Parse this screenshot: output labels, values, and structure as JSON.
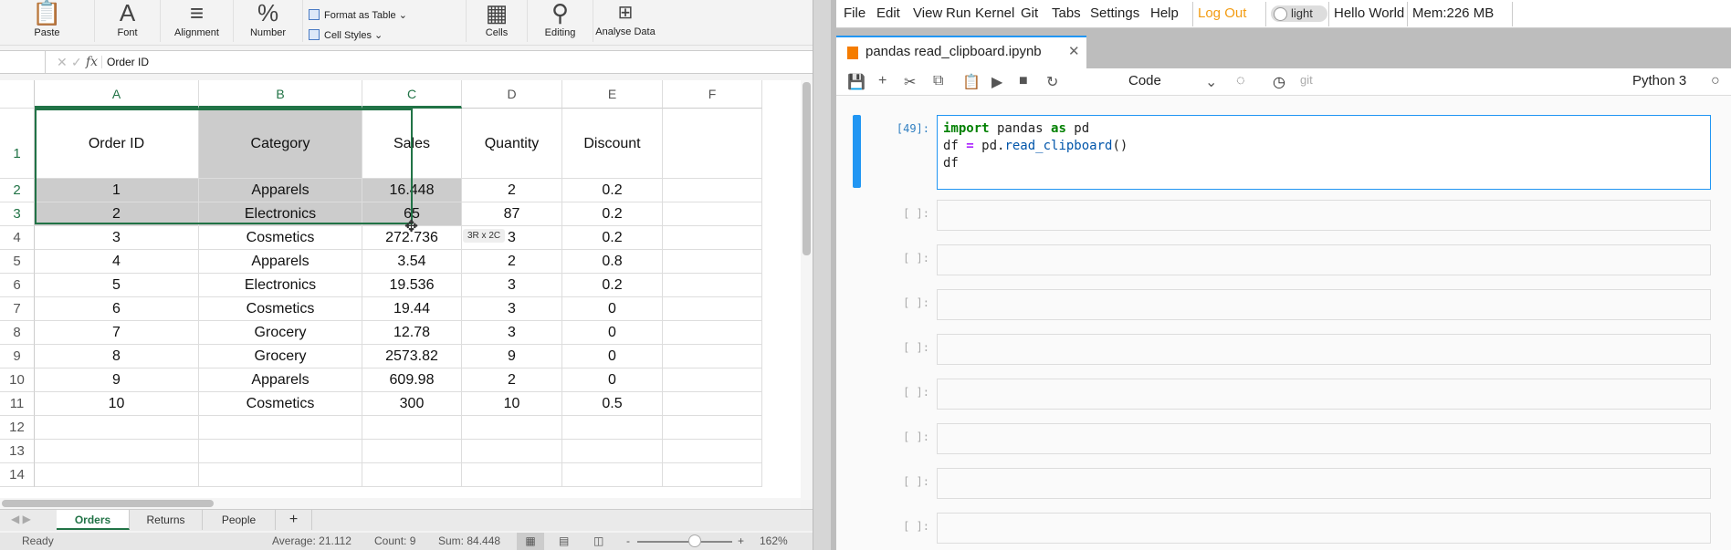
{
  "excel": {
    "ribbon": {
      "groups": [
        "Paste",
        "Font",
        "Alignment",
        "Number",
        "Cells",
        "Editing",
        "Analyse Data"
      ],
      "styles": [
        "Format as Table",
        "Cell Styles"
      ]
    },
    "formula_bar": {
      "name_box": "",
      "value": "Order ID",
      "fx": "fx"
    },
    "columns": [
      "A",
      "B",
      "C",
      "D",
      "E",
      "F"
    ],
    "rows": [
      "1",
      "2",
      "3",
      "4",
      "5",
      "6",
      "7",
      "8",
      "9",
      "10",
      "11",
      "12",
      "13",
      "14"
    ],
    "headers": [
      "Order ID",
      "Category",
      "Sales",
      "Quantity",
      "Discount"
    ],
    "data": [
      [
        "1",
        "Apparels",
        "16.448",
        "2",
        "0.2"
      ],
      [
        "2",
        "Electronics",
        "65",
        "87",
        "0.2"
      ],
      [
        "3",
        "Cosmetics",
        "272.736",
        "3",
        "0.2"
      ],
      [
        "4",
        "Apparels",
        "3.54",
        "2",
        "0.8"
      ],
      [
        "5",
        "Electronics",
        "19.536",
        "3",
        "0.2"
      ],
      [
        "6",
        "Cosmetics",
        "19.44",
        "3",
        "0"
      ],
      [
        "7",
        "Grocery",
        "12.78",
        "3",
        "0"
      ],
      [
        "8",
        "Grocery",
        "2573.82",
        "9",
        "0"
      ],
      [
        "9",
        "Apparels",
        "609.98",
        "2",
        "0"
      ],
      [
        "10",
        "Cosmetics",
        "300",
        "10",
        "0.5"
      ]
    ],
    "selection_tooltip": "3R x 2C",
    "sheet_tabs": [
      "Orders",
      "Returns",
      "People"
    ],
    "active_sheet": "Orders",
    "add_sheet": "+",
    "status": {
      "ready": "Ready",
      "average": "Average: 21.112",
      "count": "Count: 9",
      "sum": "Sum: 84.448",
      "zoom": "162%",
      "zoom_minus": "-",
      "zoom_plus": "+",
      "zoom_level_percent": 162
    },
    "accent": "#217346"
  },
  "jupyter": {
    "menu": [
      "File",
      "Edit",
      "View",
      "Run",
      "Kernel",
      "Git",
      "Tabs",
      "Settings",
      "Help"
    ],
    "logout": "Log Out",
    "theme_toggle": "light",
    "hello": "Hello World",
    "mem": "Mem:226 MB",
    "tab_title": "pandas read_clipboard.ipynb",
    "cell_type": "Code",
    "git": "git",
    "kernel": "Python 3",
    "cells": [
      {
        "prompt": "[49]:",
        "code": [
          "import pandas as pd",
          "df = pd.read_clipboard()",
          "df"
        ]
      },
      {
        "prompt": "[ ]:"
      },
      {
        "prompt": "[ ]:"
      },
      {
        "prompt": "[ ]:"
      },
      {
        "prompt": "[ ]:"
      },
      {
        "prompt": "[ ]:"
      },
      {
        "prompt": "[ ]:"
      },
      {
        "prompt": "[ ]:"
      },
      {
        "prompt": "[ ]:"
      }
    ],
    "accent": "#2196f3",
    "logout_color": "#f39c12"
  }
}
